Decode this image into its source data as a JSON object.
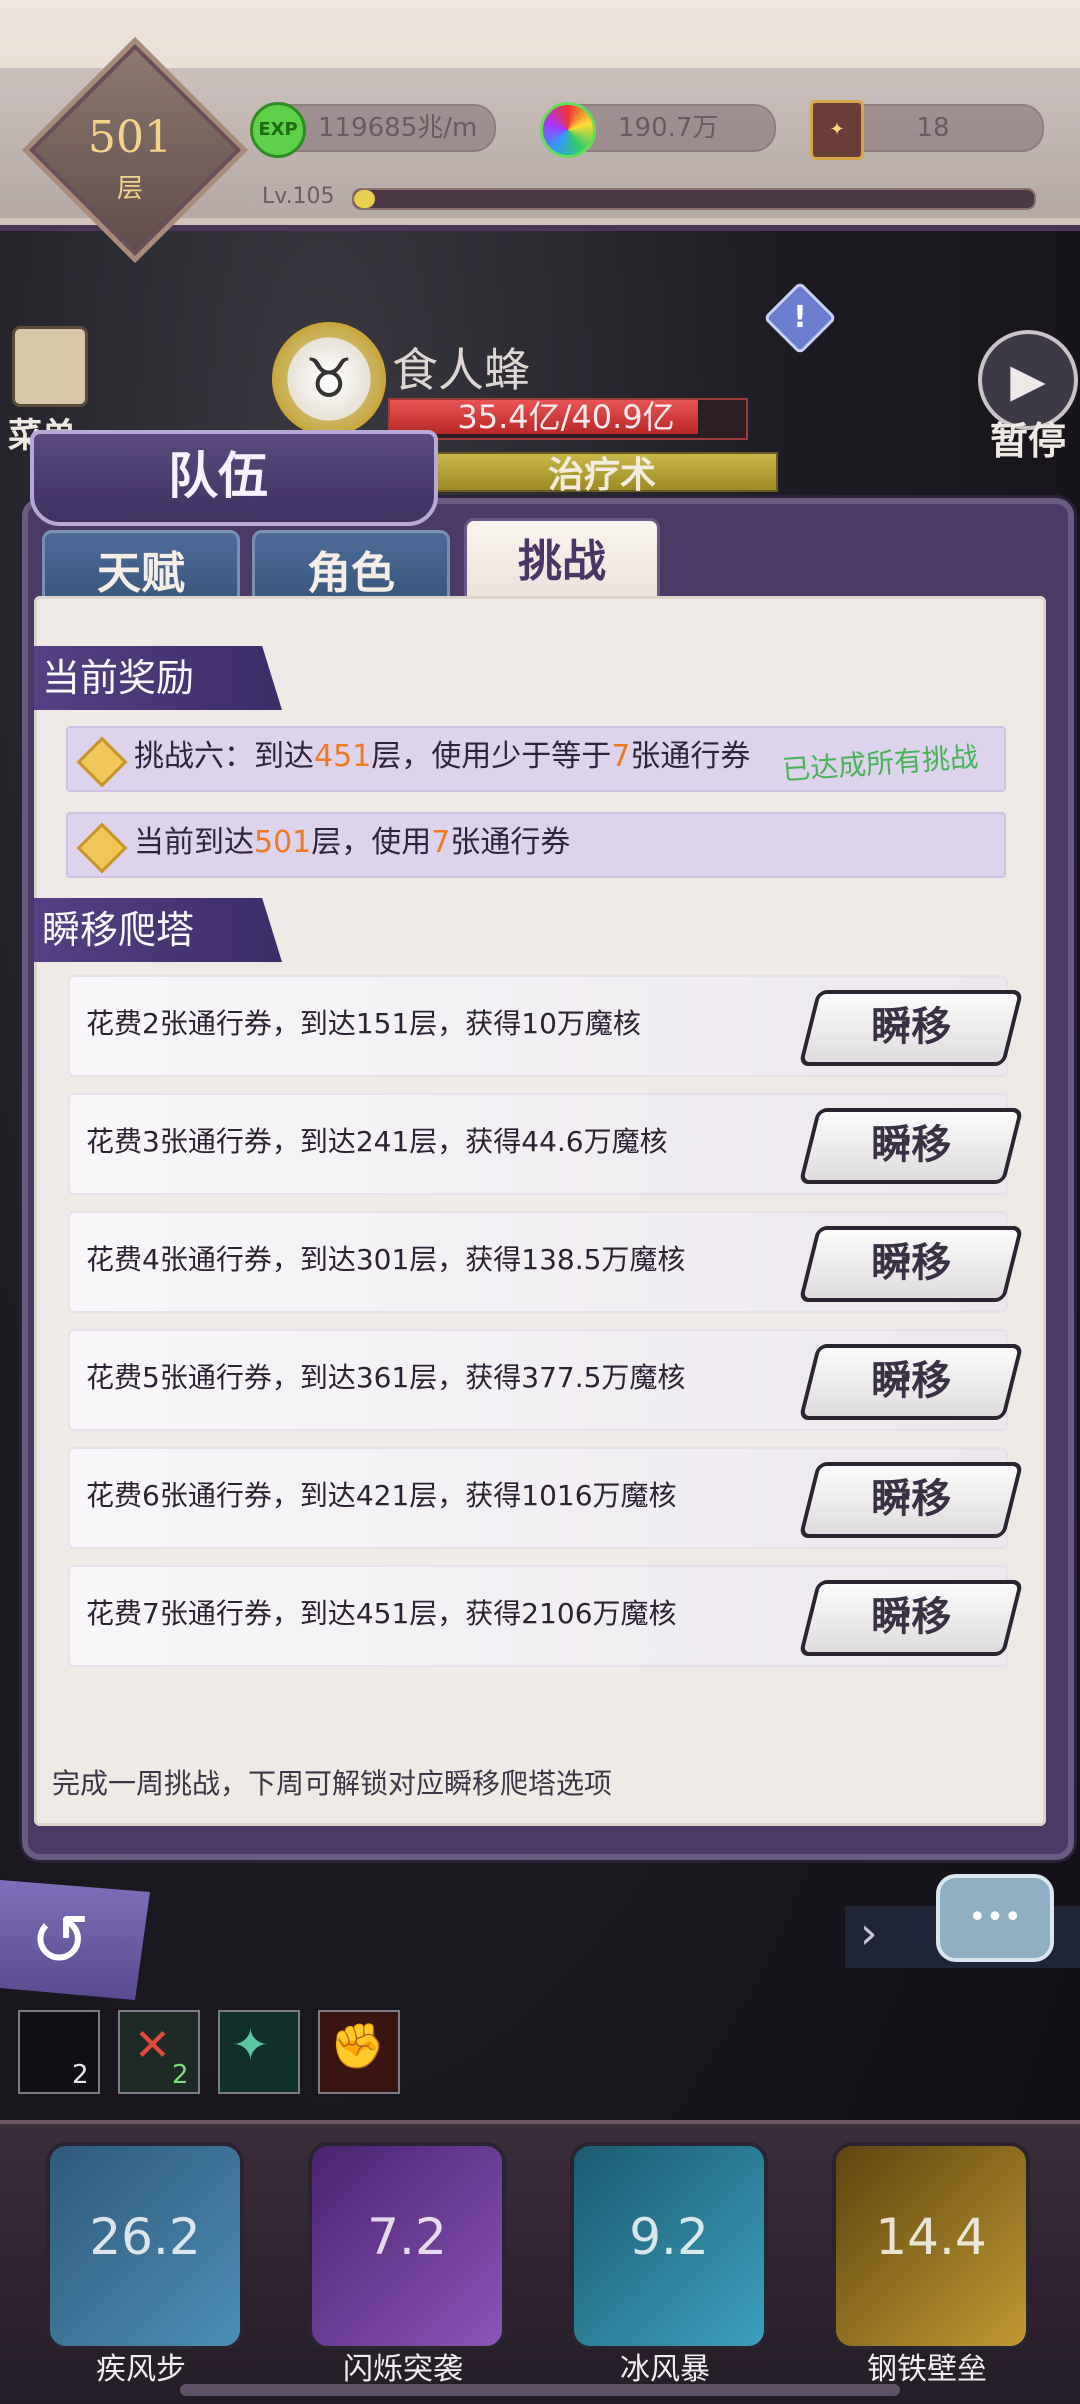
{
  "hud": {
    "floor_number": "501",
    "floor_unit": "层",
    "exp_icon_label": "EXP",
    "exp_rate": "119685兆/m",
    "orb_amount": "190.7万",
    "ticket_count": "18",
    "level": "Lv.105",
    "level_progress": 0.03
  },
  "top_controls": {
    "menu_label": "菜单",
    "pause_label": "暂停",
    "diamond_mark": "!"
  },
  "boss": {
    "name": "食人蜂",
    "hp_text": "35.4亿/40.9亿",
    "hp_fraction": 0.865,
    "skill_cast": "治疗术"
  },
  "panel": {
    "title": "队伍",
    "tabs": [
      {
        "label": "天赋"
      },
      {
        "label": "角色"
      },
      {
        "label": "挑战"
      }
    ],
    "active_tab": "挑战"
  },
  "current_reward": {
    "section_title": "当前奖励",
    "challenge": {
      "prefix": "挑战六：到达",
      "floor": "451",
      "middle": "层，使用少于等于",
      "tickets": "7",
      "suffix": "张通行券",
      "status": "已达成所有挑战"
    },
    "current": {
      "prefix": "当前到达",
      "floor": "501",
      "middle": "层，使用",
      "tickets": "7",
      "suffix": "张通行券"
    }
  },
  "teleport": {
    "section_title": "瞬移爬塔",
    "button_label": "瞬移",
    "rows": [
      {
        "text": "花费2张通行券，到达151层，获得10万魔核"
      },
      {
        "text": "花费3张通行券，到达241层，获得44.6万魔核"
      },
      {
        "text": "花费4张通行券，到达301层，获得138.5万魔核"
      },
      {
        "text": "花费5张通行券，到达361层，获得377.5万魔核"
      },
      {
        "text": "花费6张通行券，到达421层，获得1016万魔核"
      },
      {
        "text": "花费7张通行券，到达451层，获得2106万魔核"
      }
    ],
    "footer_note": "完成一周挑战，下周可解锁对应瞬移爬塔选项"
  },
  "buffs": [
    {
      "icon": "dark-slash-icon",
      "count": "2"
    },
    {
      "icon": "sword-break-icon",
      "count": "2"
    },
    {
      "icon": "treasure-icon",
      "count": ""
    },
    {
      "icon": "fire-fist-icon",
      "count": ""
    }
  ],
  "skills": [
    {
      "name": "疾风步",
      "cooldown": "26.2",
      "icon": "wind-dash-icon",
      "color": "#3a6f96"
    },
    {
      "name": "闪烁突袭",
      "cooldown": "7.2",
      "icon": "blink-strike-icon",
      "color": "#6a3c8e"
    },
    {
      "name": "冰风暴",
      "cooldown": "9.2",
      "icon": "ice-storm-icon",
      "color": "#2e7f9b"
    },
    {
      "name": "钢铁壁垒",
      "cooldown": "14.4",
      "icon": "iron-wall-icon",
      "color": "#8a6a1e"
    }
  ],
  "colors": {
    "accent_purple": "#4b3566",
    "highlight_orange": "#ef7a22",
    "achieved_green": "#48b358"
  }
}
